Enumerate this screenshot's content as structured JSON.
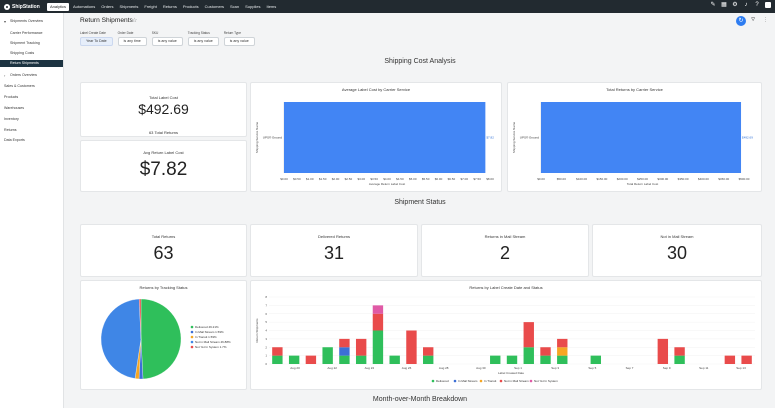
{
  "brand": {
    "name": "ShipStation"
  },
  "nav": {
    "items": [
      "Analytics",
      "Automations",
      "Orders",
      "Shipments",
      "Freight",
      "Returns",
      "Products",
      "Customers",
      "Scan",
      "Supplies",
      "Items"
    ],
    "active": "Analytics"
  },
  "sidebar": {
    "sections": [
      {
        "label": "Shipments Overview",
        "expanded": true,
        "children": [
          "Carrier Performance",
          "Shipment Tracking",
          "Shipping Costs",
          "Return Shipments"
        ]
      },
      {
        "label": "Orders Overview",
        "expanded": false
      },
      {
        "label": "Sales & Customers"
      },
      {
        "label": "Products"
      },
      {
        "label": "Warehouses"
      },
      {
        "label": "Inventory"
      },
      {
        "label": "Returns"
      },
      {
        "label": "Data Exports"
      }
    ],
    "active": "Return Shipments"
  },
  "page": {
    "title": "Return Shipments"
  },
  "filters": [
    {
      "label": "Label Create Date",
      "value": "Year To Date"
    },
    {
      "label": "Order Date",
      "value": "is any time"
    },
    {
      "label": "SKU",
      "value": "is any value"
    },
    {
      "label": "Tracking Status",
      "value": "is any value"
    },
    {
      "label": "Return Type",
      "value": "is any value"
    }
  ],
  "sections": {
    "shipping_cost": "Shipping Cost Analysis",
    "shipment_status": "Shipment Status",
    "mom": "Month-over-Month Breakdown"
  },
  "metrics": {
    "total_label_cost": {
      "title": "Total Label Cost",
      "value": "$492.69",
      "sub_count": "63",
      "sub_label": "Total Returns"
    },
    "avg_return_label_cost": {
      "title": "Avg Return Label Cost",
      "value": "$7.82"
    },
    "total_returns": {
      "title": "Total Returns",
      "value": "63"
    },
    "delivered_returns": {
      "title": "Delivered Returns",
      "value": "31"
    },
    "in_mail_stream": {
      "title": "Returns in Mail Stream",
      "value": "2"
    },
    "not_in_mail_stream": {
      "title": "Not in Mail Stream",
      "value": "30"
    }
  },
  "chart_data": [
    {
      "type": "bar",
      "orientation": "horizontal",
      "title": "Average Label Cost by Carrier Service",
      "xlabel": "Average Return Label Cost",
      "ylabel": "Shipping Service Name",
      "categories": [
        "UPS® Ground"
      ],
      "values": [
        7.82
      ],
      "data_labels": [
        "$7.82"
      ],
      "xticks": [
        "$0.00",
        "$0.50",
        "$1.00",
        "$1.50",
        "$2.00",
        "$2.50",
        "$3.00",
        "$3.50",
        "$4.00",
        "$4.50",
        "$5.00",
        "$5.50",
        "$6.00",
        "$6.50",
        "$7.00",
        "$7.50",
        "$8.00"
      ],
      "xlim": [
        0,
        8
      ],
      "color": "#4285f4"
    },
    {
      "type": "bar",
      "orientation": "horizontal",
      "title": "Total Returns by Carrier Service",
      "xlabel": "Total Return Label Cost",
      "ylabel": "Shipping Service Name",
      "categories": [
        "UPS® Ground"
      ],
      "values": [
        492.69
      ],
      "data_labels": [
        "$492.69"
      ],
      "xticks": [
        "$0.00",
        "$50.00",
        "$100.00",
        "$150.00",
        "$200.00",
        "$250.00",
        "$300.00",
        "$350.00",
        "$400.00",
        "$450.00",
        "$500.00"
      ],
      "xlim": [
        0,
        500
      ],
      "color": "#4285f4"
    },
    {
      "type": "pie",
      "title": "Returns by Tracking Status",
      "slices": [
        {
          "name": "Delivered",
          "label": "Delivered 49.21%",
          "value": 49.21,
          "color": "#2fbf5b"
        },
        {
          "name": "In Mail Stream",
          "label": "In Mail Stream 1.59%",
          "value": 1.59,
          "color": "#3c6fd6"
        },
        {
          "name": "In Transit",
          "label": "In Transit 1.59%",
          "value": 1.59,
          "color": "#f5a623"
        },
        {
          "name": "Not in Mail Stream",
          "label": "Not in Mail Stream 46.88%",
          "value": 46.88,
          "color": "#3f86e6"
        },
        {
          "name": "Not Yet In System",
          "label": "Not Yet In System 1.7%",
          "value": 0.73,
          "color": "#e94b4b"
        }
      ]
    },
    {
      "type": "bar",
      "stacked": true,
      "title": "Returns by Label Create Date and Status",
      "xlabel": "Label Created Date",
      "ylabel": "Return Shipments",
      "ylim": [
        0,
        8
      ],
      "yticks": [
        "0",
        "1",
        "2",
        "3",
        "4",
        "5",
        "6",
        "7",
        "8"
      ],
      "xticks": [
        "Aug 20",
        "Aug 22",
        "Aug 24",
        "Aug 26",
        "Aug 28",
        "Aug 30",
        "Sep 1",
        "Sep 3",
        "Sep 5",
        "Sep 7",
        "Sep 9",
        "Sep 11",
        "Sep 13"
      ],
      "series": [
        {
          "name": "Delivered",
          "color": "#2fbf5b",
          "values": [
            1,
            1,
            0,
            2,
            1,
            1,
            4,
            1,
            0,
            1,
            0,
            0,
            0,
            1,
            1,
            2,
            1,
            1,
            0,
            1,
            0,
            0,
            0,
            0,
            1,
            0,
            0,
            0,
            0
          ]
        },
        {
          "name": "In Mail Stream",
          "color": "#3c6fd6",
          "values": [
            0,
            0,
            0,
            0,
            1,
            0,
            0,
            0,
            0,
            0,
            0,
            0,
            0,
            0,
            0,
            0,
            0,
            0,
            0,
            0,
            0,
            0,
            0,
            0,
            0,
            0,
            0,
            0,
            0
          ]
        },
        {
          "name": "In Transit",
          "color": "#f5a623",
          "values": [
            0,
            0,
            0,
            0,
            0,
            0,
            0,
            0,
            0,
            0,
            0,
            0,
            0,
            0,
            0,
            0,
            0,
            1,
            0,
            0,
            0,
            0,
            0,
            0,
            0,
            0,
            0,
            0,
            0
          ]
        },
        {
          "name": "Not in Mail Stream",
          "color": "#e94b4b",
          "values": [
            1,
            0,
            1,
            0,
            1,
            2,
            2,
            0,
            4,
            1,
            0,
            0,
            0,
            0,
            0,
            3,
            1,
            1,
            0,
            0,
            0,
            0,
            0,
            3,
            1,
            0,
            0,
            1,
            1
          ]
        },
        {
          "name": "Not Yet In System",
          "color": "#e05aa6",
          "values": [
            0,
            0,
            0,
            0,
            0,
            0,
            0,
            0,
            0,
            0,
            0,
            0,
            0,
            0,
            0,
            0,
            0,
            0,
            0,
            0,
            0,
            0,
            0,
            0,
            0,
            0,
            0,
            0,
            0
          ]
        }
      ],
      "extra_top": [
        0,
        0,
        0,
        0,
        0,
        0,
        1,
        0,
        0,
        0,
        0,
        0,
        0,
        0,
        0,
        0,
        0,
        0,
        0,
        0,
        0,
        0,
        0,
        0,
        0,
        0,
        0,
        0,
        0
      ]
    }
  ]
}
